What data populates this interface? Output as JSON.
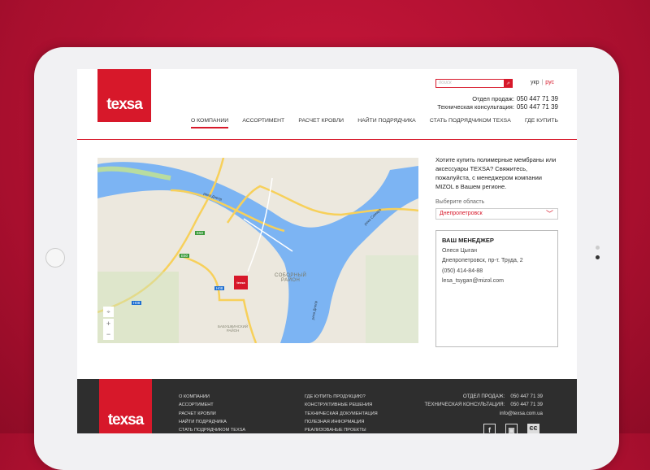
{
  "header": {
    "logo": "texsa",
    "search_placeholder": "поиск",
    "lang": {
      "ukr": "укр",
      "sep": "|",
      "rus": "рус"
    },
    "phones": [
      {
        "label": "Отдел продаж:",
        "number": "050 447 71 39"
      },
      {
        "label": "Техническая консультация:",
        "number": "050 447 71 39"
      }
    ]
  },
  "nav": [
    {
      "label": "О КОМПАНИИ",
      "active": true
    },
    {
      "label": "АССОРТИМЕНТ"
    },
    {
      "label": "РАСЧЕТ КРОВЛИ"
    },
    {
      "label": "НАЙТИ ПОДРЯДЧИКА"
    },
    {
      "label": "СТАТЬ ПОДРЯДЧИКОМ TEXSA"
    },
    {
      "label": "ГДЕ КУПИТЬ"
    }
  ],
  "map": {
    "river1": "река Днепр",
    "river2": "река Самара",
    "river3": "река Днепр",
    "district1": "СОБОРНЫЙ",
    "district1b": "РАЙОН",
    "district2": "БАБУШКИНСКИЙ",
    "district2b": "РАЙОН",
    "roads": [
      "E50",
      "E50",
      "H08",
      "H08"
    ],
    "marker": "texsa",
    "zoom_in": "+",
    "zoom_out": "−"
  },
  "sidebar": {
    "intro": "Хотите купить полимерные мембраны или аксессуары TEXSA? Свяжитесь, пожалуйста, с менеджером компании MIZOL в Вашем регионе.",
    "select_label": "Выберите область",
    "select_value": "Днепропетровск",
    "manager": {
      "title": "ВАШ МЕНЕДЖЕР",
      "name": "Олеся Цыган",
      "address": "Днепропетровск, пр-т. Труда, 2",
      "phone": "(050) 414-84-88",
      "email": "lesa_tsygan@mizol.com"
    }
  },
  "footer": {
    "logo": "texsa",
    "col1": [
      "О КОМПАНИИ",
      "АССОРТИМЕНТ",
      "РАСЧЕТ КРОВЛИ",
      "НАЙТИ ПОДРЯДЧИКА",
      "СТАТЬ ПОДРЯДЧИКОМ TEXSA"
    ],
    "col2": [
      "ГДЕ КУПИТЬ ПРОДУКЦИЮ?",
      "КОНСТРУКТИВНЫЕ РЕШЕНИЯ",
      "ТЕХНИЧЕСКАЯ ДОКУМЕНТАЦИЯ",
      "ПОЛЕЗНАЯ ИНФОРМАЦИЯ",
      "РЕАЛИЗОВАНЫЕ ПРОЕКТЫ"
    ],
    "sales_label": "ОТДЕЛ ПРОДАЖ:",
    "sales": "050 447 71 39",
    "tech_label": "ТЕХНИЧЕСКАЯ КОНСУЛЬТАЦИЯ:",
    "tech": "050 447 71 39",
    "email": "info@texsa.com.ua",
    "social": {
      "fb": "f",
      "yt": "▣",
      "ev": "ЄЄ"
    }
  }
}
